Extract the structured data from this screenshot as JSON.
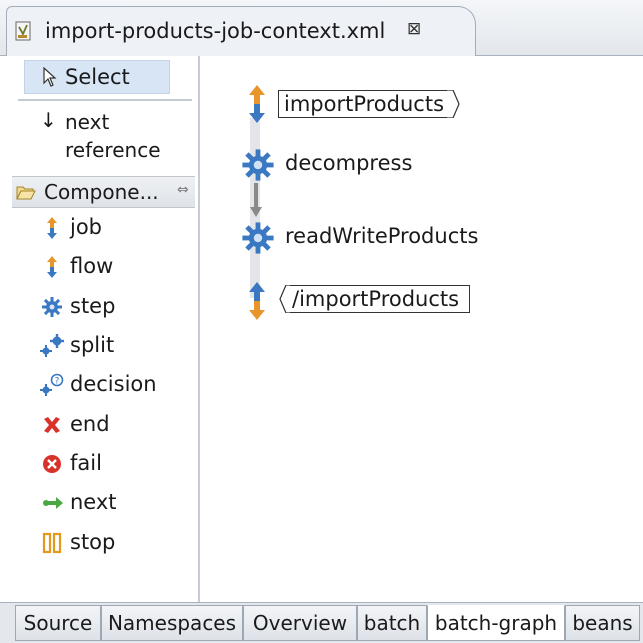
{
  "editor": {
    "tab_title": "import-products-job-context.xml",
    "close_glyph": "⊠"
  },
  "palette": {
    "select_label": "Select",
    "next_reference_arrow": "↓",
    "next_reference_label": "next reference",
    "drawer_label": "Compone...",
    "drawer_pin": "⇔",
    "items": [
      {
        "label": "job",
        "icon": "job-icon"
      },
      {
        "label": "flow",
        "icon": "flow-icon"
      },
      {
        "label": "step",
        "icon": "step-icon"
      },
      {
        "label": "split",
        "icon": "split-icon"
      },
      {
        "label": "decision",
        "icon": "decision-icon"
      },
      {
        "label": "end",
        "icon": "end-icon"
      },
      {
        "label": "fail",
        "icon": "fail-icon"
      },
      {
        "label": "next",
        "icon": "next-icon"
      },
      {
        "label": "stop",
        "icon": "stop-icon"
      }
    ]
  },
  "canvas": {
    "job_start_label": "importProducts",
    "step1_label": "decompress",
    "step2_label": "readWriteProducts",
    "job_end_label": "/importProducts"
  },
  "bottom_tabs": [
    {
      "label": "Source",
      "active": false
    },
    {
      "label": "Namespaces",
      "active": false
    },
    {
      "label": "Overview",
      "active": false
    },
    {
      "label": "batch",
      "active": false
    },
    {
      "label": "batch-graph",
      "active": true
    },
    {
      "label": "beans",
      "active": false
    }
  ],
  "colors": {
    "selection_bg": "#d7e5f5",
    "gear_blue": "#3a78c2",
    "arrow_orange": "#e8962c",
    "end_red": "#d9322b",
    "next_green": "#4aa843",
    "stop_orange": "#e39a1c"
  }
}
